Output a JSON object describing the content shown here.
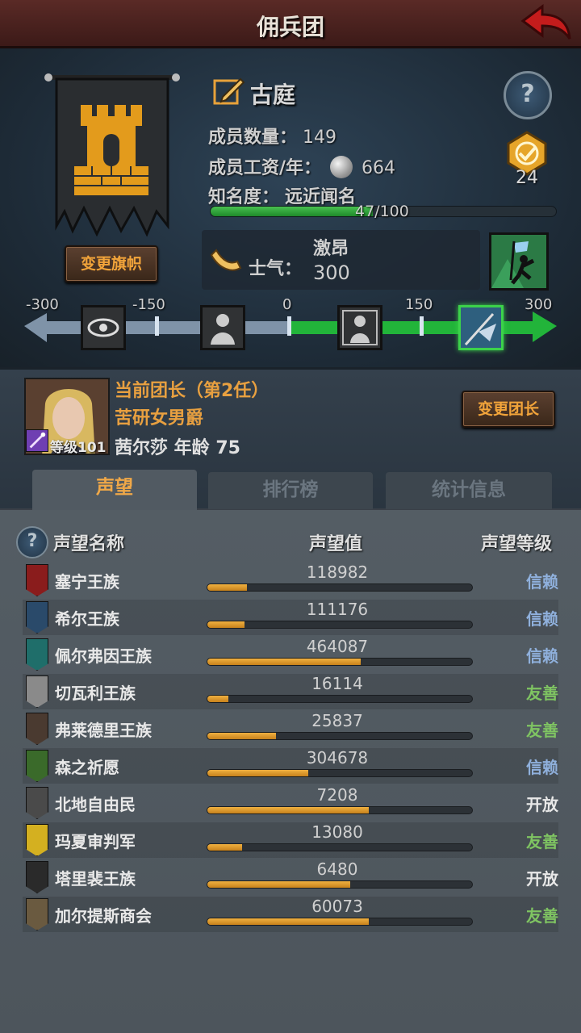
{
  "header": {
    "title": "佣兵团"
  },
  "guild": {
    "name": "古庭",
    "change_banner_label": "变更旗帜",
    "members_label": "成员数量：",
    "members_value": "149",
    "salary_label": "成员工资/年：",
    "salary_value": "664",
    "fame_label": "知名度：",
    "fame_state": "远近闻名",
    "fame_progress": "47/100",
    "fame_fraction": 0.47,
    "medal_count": "24"
  },
  "morale": {
    "label": "士气：",
    "state": "激昂",
    "value": "300",
    "scale_ticks": [
      "-300",
      "-150",
      "0",
      "150",
      "300"
    ],
    "scale_fraction": 1.0
  },
  "leader": {
    "title": "当前团长（第2任）",
    "rank": "苦研女男爵",
    "level_label": "等级101",
    "name_age": "茜尔莎  年龄  75",
    "change_label": "变更团长"
  },
  "tabs": [
    {
      "label": "声望",
      "active": true
    },
    {
      "label": "排行榜",
      "active": false
    },
    {
      "label": "统计信息",
      "active": false
    }
  ],
  "table": {
    "headers": [
      "声望名称",
      "声望值",
      "声望等级"
    ],
    "rows": [
      {
        "name": "塞宁王族",
        "value": "118982",
        "level": "信赖",
        "fill": 0.15,
        "level_color": "#8fb0dc",
        "crest_color": "#8a1c1c"
      },
      {
        "name": "希尔王族",
        "value": "111176",
        "level": "信赖",
        "fill": 0.14,
        "level_color": "#8fb0dc",
        "crest_color": "#2a4a6a"
      },
      {
        "name": "佩尔弗因王族",
        "value": "464087",
        "level": "信赖",
        "fill": 0.58,
        "level_color": "#8fb0dc",
        "crest_color": "#1f6e6a"
      },
      {
        "name": "切瓦利王族",
        "value": "16114",
        "level": "友善",
        "fill": 0.08,
        "level_color": "#7fc462",
        "crest_color": "#8a8a8a"
      },
      {
        "name": "弗莱德里王族",
        "value": "25837",
        "level": "友善",
        "fill": 0.26,
        "level_color": "#7fc462",
        "crest_color": "#4a3a30"
      },
      {
        "name": "森之祈愿",
        "value": "304678",
        "level": "信赖",
        "fill": 0.38,
        "level_color": "#8fb0dc",
        "crest_color": "#3a6a2a"
      },
      {
        "name": "北地自由民",
        "value": "7208",
        "level": "开放",
        "fill": 0.61,
        "level_color": "#e8e8e8",
        "crest_color": "#4a4a4a"
      },
      {
        "name": "玛夏审判军",
        "value": "13080",
        "level": "友善",
        "fill": 0.13,
        "level_color": "#7fc462",
        "crest_color": "#d4b020"
      },
      {
        "name": "塔里裴王族",
        "value": "6480",
        "level": "开放",
        "fill": 0.54,
        "level_color": "#e8e8e8",
        "crest_color": "#2a2a2a"
      },
      {
        "name": "加尔提斯商会",
        "value": "60073",
        "level": "友善",
        "fill": 0.61,
        "level_color": "#7fc462",
        "crest_color": "#6a5a40"
      }
    ]
  }
}
